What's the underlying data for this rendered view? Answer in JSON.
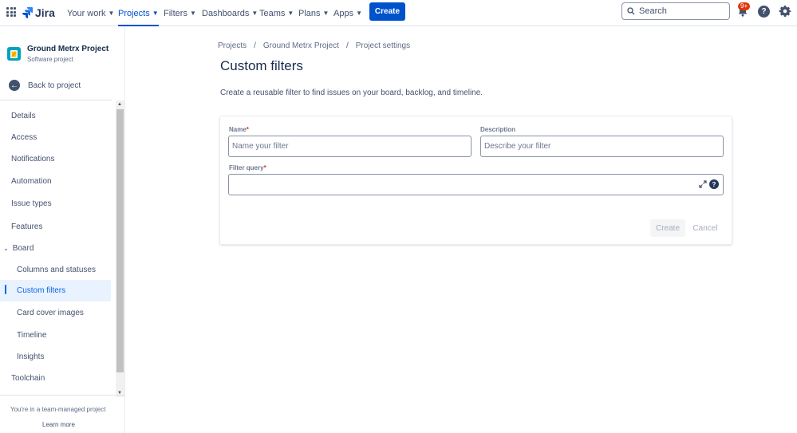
{
  "topnav": {
    "logo_text": "Jira",
    "items": [
      {
        "label": "Your work"
      },
      {
        "label": "Projects"
      },
      {
        "label": "Filters"
      },
      {
        "label": "Dashboards"
      },
      {
        "label": "Teams"
      },
      {
        "label": "Plans"
      },
      {
        "label": "Apps"
      }
    ],
    "active_item": "Projects",
    "create_label": "Create",
    "search_placeholder": "Search",
    "notification_badge": "9+",
    "help_glyph": "?",
    "accent_color": "#0052cc"
  },
  "sidebar": {
    "project_name": "Ground Metrx Project",
    "project_type": "Software project",
    "back_label": "Back to project",
    "items": [
      {
        "label": "Details"
      },
      {
        "label": "Access"
      },
      {
        "label": "Notifications"
      },
      {
        "label": "Automation"
      },
      {
        "label": "Issue types"
      },
      {
        "label": "Features"
      },
      {
        "label": "Board"
      },
      {
        "label": "Columns and statuses"
      },
      {
        "label": "Custom filters"
      },
      {
        "label": "Card cover images"
      },
      {
        "label": "Timeline"
      },
      {
        "label": "Insights"
      },
      {
        "label": "Toolchain"
      }
    ],
    "selected_item": "Custom filters",
    "team_note": "You're in a team-managed project",
    "learn_more": "Learn more"
  },
  "main": {
    "breadcrumb": [
      "Projects",
      "Ground Metrx Project",
      "Project settings"
    ],
    "breadcrumb_separator": "/",
    "title": "Custom filters",
    "description": "Create a reusable filter to find issues on your board, backlog, and timeline.",
    "form": {
      "name_label": "Name",
      "required_mark": "*",
      "name_placeholder": "Name your filter",
      "description_label": "Description",
      "description_placeholder": "Describe your filter",
      "query_label": "Filter query",
      "query_value": "",
      "create_label": "Create",
      "cancel_label": "Cancel"
    }
  }
}
